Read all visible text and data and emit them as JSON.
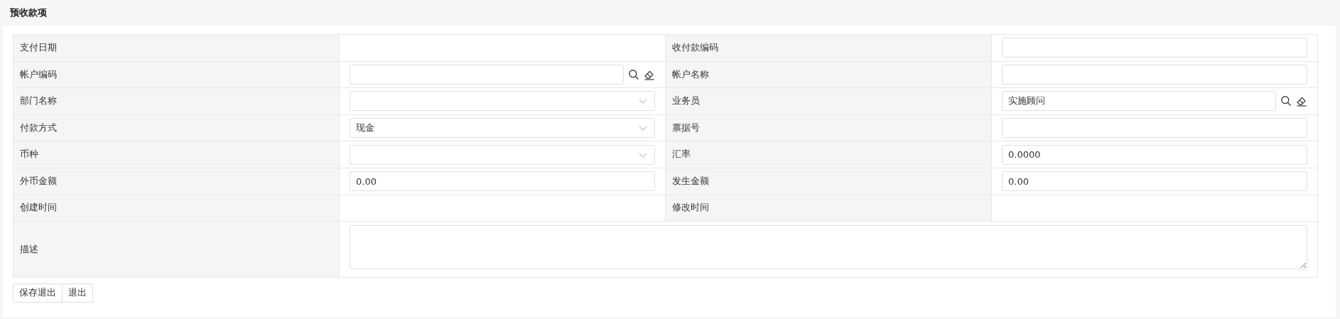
{
  "section_title": "预收款项",
  "rows": [
    {
      "cells": [
        {
          "label": "支付日期",
          "kind": "readonly"
        },
        {
          "label": "收付款编码",
          "kind": "text"
        }
      ]
    },
    {
      "cells": [
        {
          "label": "帐户编码",
          "kind": "lookup"
        },
        {
          "label": "帐户名称",
          "kind": "text"
        }
      ]
    },
    {
      "cells": [
        {
          "label": "部门名称",
          "kind": "select"
        },
        {
          "label": "业务员",
          "kind": "lookup",
          "value": "实施顾问"
        }
      ]
    },
    {
      "cells": [
        {
          "label": "付款方式",
          "kind": "select",
          "value": "现金"
        },
        {
          "label": "票据号",
          "kind": "text"
        }
      ]
    },
    {
      "cells": [
        {
          "label": "币种",
          "kind": "select"
        },
        {
          "label": "汇率",
          "kind": "text",
          "value": "0.0000"
        }
      ]
    },
    {
      "cells": [
        {
          "label": "外币金额",
          "kind": "text",
          "value": "0.00"
        },
        {
          "label": "发生金额",
          "kind": "text",
          "value": "0.00"
        }
      ]
    },
    {
      "cells": [
        {
          "label": "创建时间",
          "kind": "readonly"
        },
        {
          "label": "修改时间",
          "kind": "readonly"
        }
      ]
    }
  ],
  "description": {
    "label": "描述",
    "kind": "textarea"
  },
  "buttons": [
    "保存退出",
    "退出"
  ]
}
